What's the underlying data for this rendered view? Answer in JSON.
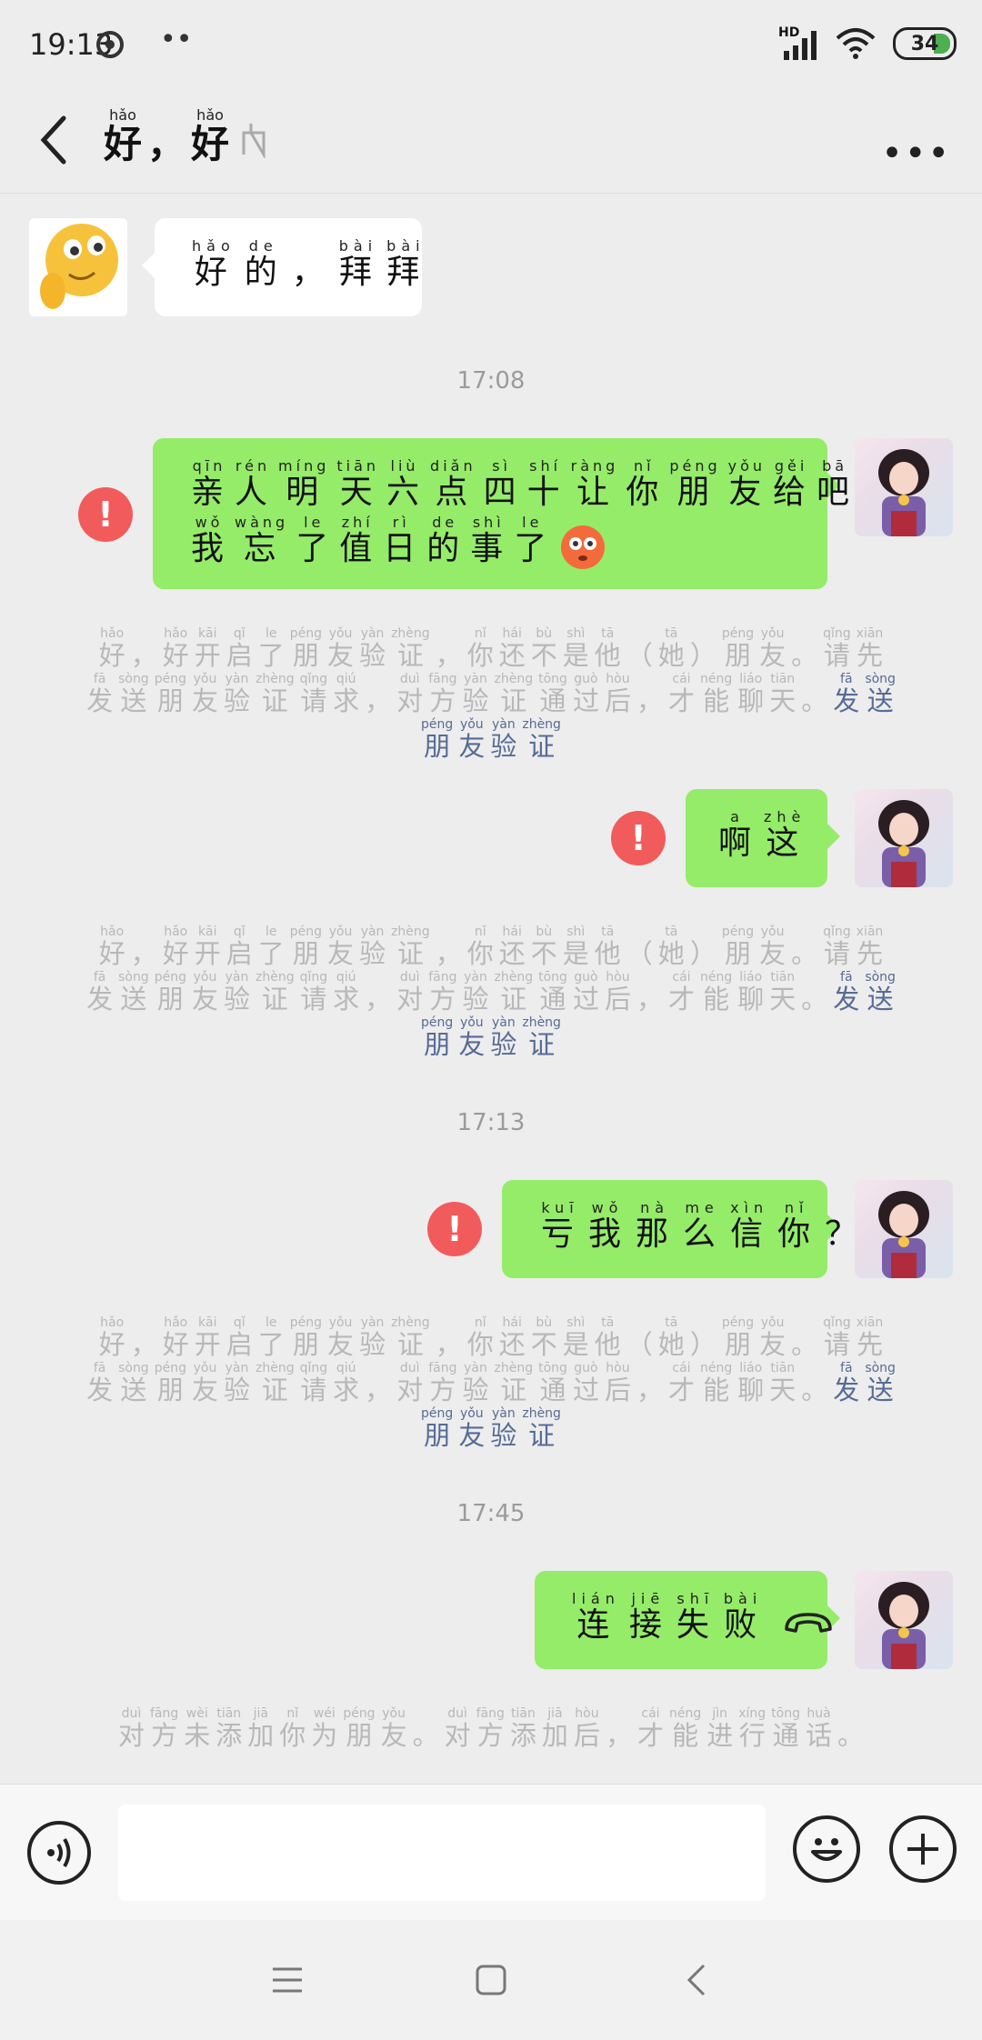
{
  "status_bar": {
    "time": "19:13",
    "network": "HD",
    "battery": "34"
  },
  "header": {
    "title": [
      {
        "py": "hǎo",
        "hz": "好"
      },
      {
        "py": "",
        "hz": "，"
      },
      {
        "py": "hǎo",
        "hz": "好"
      }
    ],
    "more_label": "•••"
  },
  "messages": [
    {
      "type": "received",
      "text": [
        {
          "py": "hǎo",
          "hz": "好"
        },
        {
          "py": "de",
          "hz": "的"
        },
        {
          "py": "",
          "hz": "，"
        },
        {
          "py": "bài",
          "hz": "拜"
        },
        {
          "py": "bài",
          "hz": "拜"
        }
      ]
    }
  ],
  "timestamps": [
    "17:08",
    "17:13",
    "17:45"
  ],
  "sent": [
    {
      "line1": [
        {
          "py": "qīn",
          "hz": "亲"
        },
        {
          "py": "rén",
          "hz": "人"
        },
        {
          "py": "míng",
          "hz": "明"
        },
        {
          "py": "tiān",
          "hz": "天"
        },
        {
          "py": "liù",
          "hz": "六"
        },
        {
          "py": "diǎn",
          "hz": "点"
        },
        {
          "py": "sì",
          "hz": "四"
        },
        {
          "py": "shí",
          "hz": "十"
        },
        {
          "py": "ràng",
          "hz": "让"
        },
        {
          "py": "nǐ",
          "hz": "你"
        },
        {
          "py": "péng",
          "hz": "朋"
        },
        {
          "py": "yǒu",
          "hz": "友"
        },
        {
          "py": "gěi",
          "hz": "给"
        },
        {
          "py": "bā",
          "hz": "吧"
        },
        {
          "py": "",
          "hz": "，"
        }
      ],
      "line2": [
        {
          "py": "wǒ",
          "hz": "我"
        },
        {
          "py": "wàng",
          "hz": "忘"
        },
        {
          "py": "le",
          "hz": "了"
        },
        {
          "py": "zhí",
          "hz": "值"
        },
        {
          "py": "rì",
          "hz": "日"
        },
        {
          "py": "de",
          "hz": "的"
        },
        {
          "py": "shì",
          "hz": "事"
        },
        {
          "py": "le",
          "hz": "了"
        }
      ],
      "emoji": "flushed-face-icon"
    },
    {
      "line1": [
        {
          "py": "a",
          "hz": "啊"
        },
        {
          "py": "zhè",
          "hz": "这"
        }
      ]
    },
    {
      "line1": [
        {
          "py": "kuī",
          "hz": "亏"
        },
        {
          "py": "wǒ",
          "hz": "我"
        },
        {
          "py": "nà",
          "hz": "那"
        },
        {
          "py": "me",
          "hz": "么"
        },
        {
          "py": "xìn",
          "hz": "信"
        },
        {
          "py": "nǐ",
          "hz": "你"
        },
        {
          "py": "",
          "hz": "？"
        }
      ]
    },
    {
      "line1": [
        {
          "py": "lián",
          "hz": "连"
        },
        {
          "py": "jiē",
          "hz": "接"
        },
        {
          "py": "shī",
          "hz": "失"
        },
        {
          "py": "bài",
          "hz": "败"
        }
      ],
      "icon": "hangup-phone-icon"
    }
  ],
  "system_notice": {
    "line1": [
      {
        "py": "hǎo",
        "hz": "好"
      },
      {
        "py": "",
        "hz": "，"
      },
      {
        "py": "hǎo",
        "hz": "好"
      },
      {
        "py": "kāi",
        "hz": "开"
      },
      {
        "py": "qǐ",
        "hz": "启"
      },
      {
        "py": "le",
        "hz": "了"
      },
      {
        "py": "péng",
        "hz": "朋"
      },
      {
        "py": "yǒu",
        "hz": "友"
      },
      {
        "py": "yàn",
        "hz": "验"
      },
      {
        "py": "zhèng",
        "hz": "证"
      },
      {
        "py": "",
        "hz": "，"
      },
      {
        "py": "nǐ",
        "hz": "你"
      },
      {
        "py": "hái",
        "hz": "还"
      },
      {
        "py": "bù",
        "hz": "不"
      },
      {
        "py": "shì",
        "hz": "是"
      },
      {
        "py": "tā",
        "hz": "他"
      },
      {
        "py": "",
        "hz": "（"
      },
      {
        "py": "tā",
        "hz": "她"
      },
      {
        "py": "",
        "hz": "）"
      },
      {
        "py": "péng",
        "hz": "朋"
      },
      {
        "py": "yǒu",
        "hz": "友"
      },
      {
        "py": "",
        "hz": "。"
      },
      {
        "py": "qǐng",
        "hz": "请"
      },
      {
        "py": "xiān",
        "hz": "先"
      }
    ],
    "line2": [
      {
        "py": "fā",
        "hz": "发"
      },
      {
        "py": "sòng",
        "hz": "送"
      },
      {
        "py": "péng",
        "hz": "朋"
      },
      {
        "py": "yǒu",
        "hz": "友"
      },
      {
        "py": "yàn",
        "hz": "验"
      },
      {
        "py": "zhèng",
        "hz": "证"
      },
      {
        "py": "qǐng",
        "hz": "请"
      },
      {
        "py": "qiú",
        "hz": "求"
      },
      {
        "py": "",
        "hz": "，"
      },
      {
        "py": "duì",
        "hz": "对"
      },
      {
        "py": "fāng",
        "hz": "方"
      },
      {
        "py": "yàn",
        "hz": "验"
      },
      {
        "py": "zhèng",
        "hz": "证"
      },
      {
        "py": "tōng",
        "hz": "通"
      },
      {
        "py": "guò",
        "hz": "过"
      },
      {
        "py": "hòu",
        "hz": "后"
      },
      {
        "py": "",
        "hz": "，"
      },
      {
        "py": "cái",
        "hz": "才"
      },
      {
        "py": "néng",
        "hz": "能"
      },
      {
        "py": "liáo",
        "hz": "聊"
      },
      {
        "py": "tiān",
        "hz": "天"
      },
      {
        "py": "",
        "hz": "。"
      }
    ],
    "link_send": [
      {
        "py": "fā",
        "hz": "发"
      },
      {
        "py": "sòng",
        "hz": "送"
      }
    ],
    "link_verify": [
      {
        "py": "péng",
        "hz": "朋"
      },
      {
        "py": "yǒu",
        "hz": "友"
      },
      {
        "py": "yàn",
        "hz": "验"
      },
      {
        "py": "zhèng",
        "hz": "证"
      }
    ]
  },
  "call_notice": [
    {
      "py": "duì",
      "hz": "对"
    },
    {
      "py": "fāng",
      "hz": "方"
    },
    {
      "py": "wèi",
      "hz": "未"
    },
    {
      "py": "tiān",
      "hz": "添"
    },
    {
      "py": "jiā",
      "hz": "加"
    },
    {
      "py": "nǐ",
      "hz": "你"
    },
    {
      "py": "wéi",
      "hz": "为"
    },
    {
      "py": "péng",
      "hz": "朋"
    },
    {
      "py": "yǒu",
      "hz": "友"
    },
    {
      "py": "",
      "hz": "。"
    },
    {
      "py": "duì",
      "hz": "对"
    },
    {
      "py": "fāng",
      "hz": "方"
    },
    {
      "py": "tiān",
      "hz": "添"
    },
    {
      "py": "jiā",
      "hz": "加"
    },
    {
      "py": "hòu",
      "hz": "后"
    },
    {
      "py": "",
      "hz": "，"
    },
    {
      "py": "cái",
      "hz": "才"
    },
    {
      "py": "néng",
      "hz": "能"
    },
    {
      "py": "jìn",
      "hz": "进"
    },
    {
      "py": "xíng",
      "hz": "行"
    },
    {
      "py": "tōng",
      "hz": "通"
    },
    {
      "py": "huà",
      "hz": "话"
    },
    {
      "py": "",
      "hz": "。"
    }
  ],
  "error_mark": "!",
  "input": {
    "value": "",
    "placeholder": ""
  }
}
